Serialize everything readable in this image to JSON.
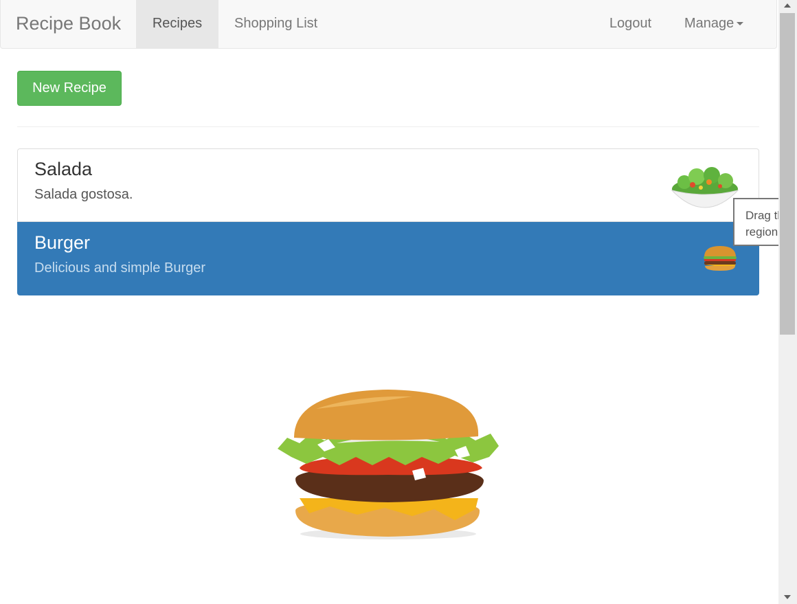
{
  "navbar": {
    "brand": "Recipe Book",
    "links": [
      "Recipes",
      "Shopping List"
    ],
    "logout": "Logout",
    "manage": "Manage",
    "active": "Recipes"
  },
  "actions": {
    "new_recipe": "New Recipe"
  },
  "recipes": [
    {
      "name": "Salada",
      "description": "Salada gostosa.",
      "image": "salad-bowl-image",
      "selected": false
    },
    {
      "name": "Burger",
      "description": "Delicious and simple Burger",
      "image": "burger-image",
      "selected": true
    }
  ],
  "detail": {
    "image": "burger-image"
  },
  "tooltip": {
    "text": "Drag the region"
  },
  "colors": {
    "success": "#5cb85c",
    "active": "#337ab7",
    "navbar_bg": "#f8f8f8"
  }
}
